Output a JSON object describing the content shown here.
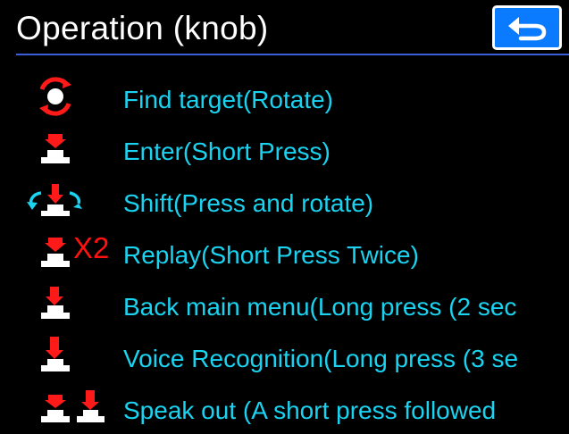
{
  "header": {
    "title": "Operation (knob)",
    "back_icon": "return-arrow-icon"
  },
  "colors": {
    "background": "#000000",
    "title_text": "#ffffff",
    "item_text": "#19d3f0",
    "icon_red": "#ff1a1a",
    "button_bg": "#0a7bff",
    "divider": "#3a5fd9"
  },
  "items": [
    {
      "label": "Find target(Rotate)",
      "icon": "rotate-knob-icon"
    },
    {
      "label": "Enter(Short Press)",
      "icon": "short-press-icon"
    },
    {
      "label": "Shift(Press and rotate)",
      "icon": "press-rotate-icon"
    },
    {
      "label": "Replay(Short Press Twice)",
      "icon": "double-press-icon",
      "badge": "X2"
    },
    {
      "label": "Back main menu(Long press (2 sec",
      "icon": "long-press-icon"
    },
    {
      "label": "Voice Recognition(Long press (3 se",
      "icon": "long-press-icon"
    },
    {
      "label": "Speak out (A short press followed",
      "icon": "short-long-press-icon"
    }
  ]
}
